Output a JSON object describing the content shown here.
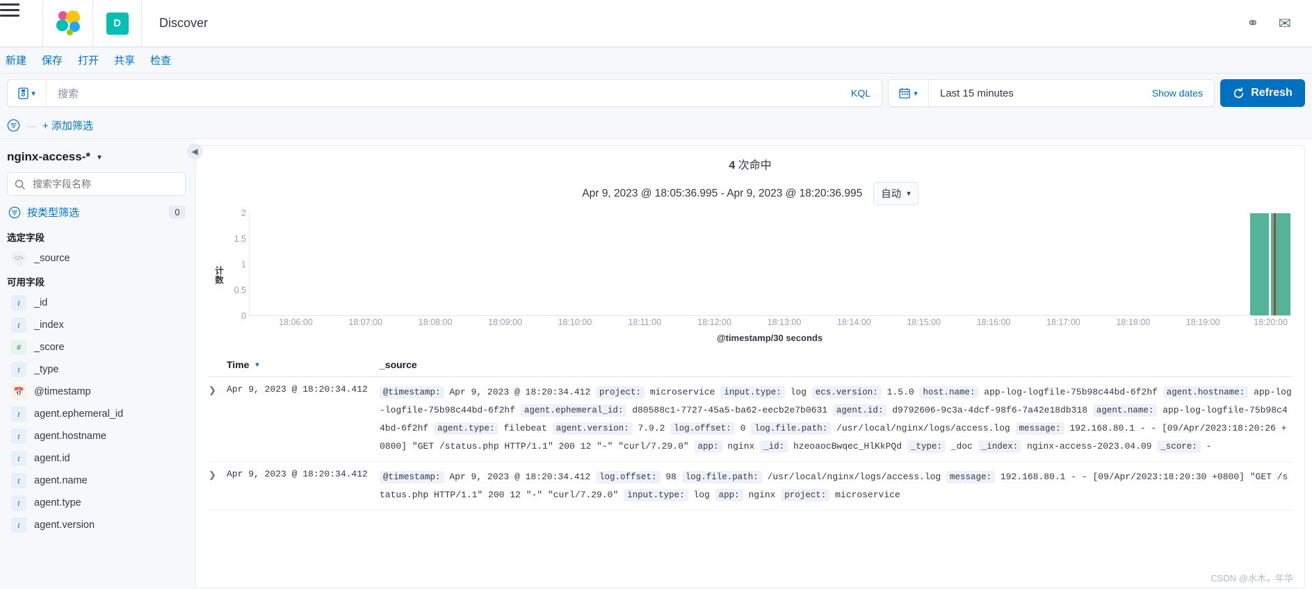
{
  "chrome": {
    "menu_icon": "hamburger-menu-icon",
    "logo_icon": "elastic-logo-icon",
    "app_badge": "D",
    "app_title": "Discover",
    "right_icons": [
      "help-globe-icon",
      "mail-envelope-icon"
    ]
  },
  "top_menu": {
    "items": [
      {
        "label": "新建",
        "name": "new"
      },
      {
        "label": "保存",
        "name": "save"
      },
      {
        "label": "打开",
        "name": "open"
      },
      {
        "label": "共享",
        "name": "share"
      },
      {
        "label": "检查",
        "name": "inspect"
      }
    ]
  },
  "query_bar": {
    "saved_query_icon": "saved-query-icon",
    "search_placeholder": "搜索",
    "language": "KQL",
    "calendar_icon": "calendar-icon",
    "date_value": "Last 15 minutes",
    "show_dates": "Show dates",
    "refresh_label": "Refresh",
    "refresh_icon": "refresh-icon",
    "refresh_color": "#0070c1"
  },
  "filter_bar": {
    "filter_icon": "filter-icon",
    "dash": "—",
    "add_filter": "+ 添加筛选"
  },
  "sidebar": {
    "index_pattern": "nginx-access-*",
    "index_pattern_caret": "chevron-down-icon",
    "field_search_placeholder": "搜索字段名称",
    "type_filter_label": "按类型筛选",
    "type_filter_count": "0",
    "selected_fields_title": "选定字段",
    "selected_fields": [
      {
        "name": "_source",
        "type": "src"
      }
    ],
    "available_fields_title": "可用字段",
    "available_fields": [
      {
        "name": "_id",
        "type": "t"
      },
      {
        "name": "_index",
        "type": "t"
      },
      {
        "name": "_score",
        "type": "num"
      },
      {
        "name": "_type",
        "type": "t"
      },
      {
        "name": "@timestamp",
        "type": "date"
      },
      {
        "name": "agent.ephemeral_id",
        "type": "t"
      },
      {
        "name": "agent.hostname",
        "type": "t"
      },
      {
        "name": "agent.id",
        "type": "t"
      },
      {
        "name": "agent.name",
        "type": "t"
      },
      {
        "name": "agent.type",
        "type": "t"
      },
      {
        "name": "agent.version",
        "type": "t"
      }
    ]
  },
  "main": {
    "collapse_icon": "collapse-left-icon",
    "hits_count": "4",
    "hits_suffix": "次命中",
    "time_range": "Apr 9, 2023 @ 18:05:36.995 - Apr 9, 2023 @ 18:20:36.995",
    "interval_label": "自动",
    "interval_caret": "chevron-down-icon"
  },
  "chart_data": {
    "type": "bar",
    "title": "",
    "xlabel": "@timestamp/30 seconds",
    "ylabel": "计数",
    "ylim": [
      0,
      2
    ],
    "yticks": [
      "0",
      "0.5",
      "1",
      "1.5",
      "2"
    ],
    "xticks": [
      "18:06:00",
      "18:07:00",
      "18:08:00",
      "18:09:00",
      "18:10:00",
      "18:11:00",
      "18:12:00",
      "18:13:00",
      "18:14:00",
      "18:15:00",
      "18:16:00",
      "18:17:00",
      "18:18:00",
      "18:19:00",
      "18:20:00"
    ],
    "bar_color": "#54b399",
    "marker_color": "#a63a2a",
    "grid": false,
    "legend": "none",
    "categories": [
      "18:20:00",
      "18:20:30"
    ],
    "values": [
      2,
      2
    ]
  },
  "doc_table": {
    "columns": [
      "Time",
      "_source"
    ],
    "sort_icon": "sort-desc-caret-icon",
    "expand_icon": "expand-row-caret-icon",
    "rows": [
      {
        "time": "Apr 9, 2023 @ 18:20:34.412",
        "fields": [
          {
            "k": "@timestamp:",
            "v": "Apr 9, 2023 @ 18:20:34.412"
          },
          {
            "k": "project:",
            "v": "microservice"
          },
          {
            "k": "input.type:",
            "v": "log"
          },
          {
            "k": "ecs.version:",
            "v": "1.5.0"
          },
          {
            "k": "host.name:",
            "v": "app-log-logfile-75b98c44bd-6f2hf"
          },
          {
            "k": "agent.hostname:",
            "v": "app-log-logfile-75b98c44bd-6f2hf"
          },
          {
            "k": "agent.ephemeral_id:",
            "v": "d80588c1-7727-45a5-ba62-eecb2e7b0631"
          },
          {
            "k": "agent.id:",
            "v": "d9792606-9c3a-4dcf-98f6-7a42e18db318"
          },
          {
            "k": "agent.name:",
            "v": "app-log-logfile-75b98c44bd-6f2hf"
          },
          {
            "k": "agent.type:",
            "v": "filebeat"
          },
          {
            "k": "agent.version:",
            "v": "7.9.2"
          },
          {
            "k": "log.offset:",
            "v": "0"
          },
          {
            "k": "log.file.path:",
            "v": "/usr/local/nginx/logs/access.log"
          },
          {
            "k": "message:",
            "v": "192.168.80.1 - - [09/Apr/2023:18:20:26 +0800] \"GET /status.php HTTP/1.1\" 200 12 \"-\" \"curl/7.29.0\""
          },
          {
            "k": "app:",
            "v": "nginx"
          },
          {
            "k": "_id:",
            "v": "hzeoaocBwqec_HlKkPQd"
          },
          {
            "k": "_type:",
            "v": "_doc"
          },
          {
            "k": "_index:",
            "v": "nginx-access-2023.04.09"
          },
          {
            "k": "_score:",
            "v": "-"
          }
        ]
      },
      {
        "time": "Apr 9, 2023 @ 18:20:34.412",
        "fields": [
          {
            "k": "@timestamp:",
            "v": "Apr 9, 2023 @ 18:20:34.412"
          },
          {
            "k": "log.offset:",
            "v": "98"
          },
          {
            "k": "log.file.path:",
            "v": "/usr/local/nginx/logs/access.log"
          },
          {
            "k": "message:",
            "v": "192.168.80.1 - - [09/Apr/2023:18:20:30 +0800] \"GET /status.php HTTP/1.1\" 200 12 \"-\" \"curl/7.29.0\""
          },
          {
            "k": "input.type:",
            "v": "log"
          },
          {
            "k": "app:",
            "v": "nginx"
          },
          {
            "k": "project:",
            "v": "microservice"
          }
        ]
      }
    ]
  },
  "watermark": "CSDN @水木，年华"
}
